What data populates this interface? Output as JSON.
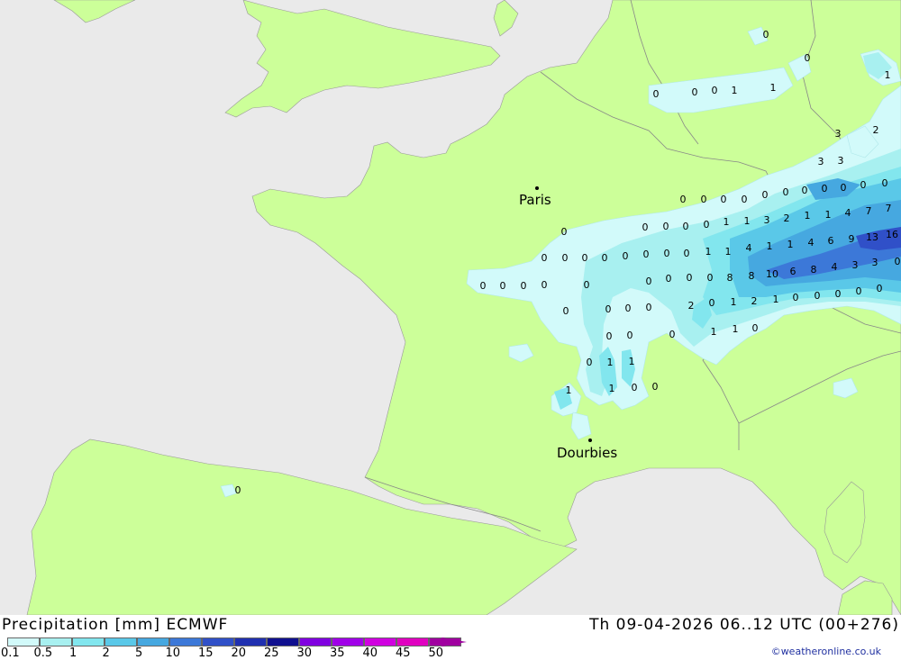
{
  "title": "Precipitation [mm] ECMWF",
  "datetime": "Th 09-04-2026 06..12 UTC (00+276)",
  "credit": "©weatheronline.co.uk",
  "colors": {
    "sea": "#eaeaea",
    "land": "#ccff99",
    "border": "#888888"
  },
  "legend": [
    {
      "label": "0.1",
      "color": "#d2fafa"
    },
    {
      "label": "0.5",
      "color": "#a8f0f0"
    },
    {
      "label": "1",
      "color": "#82e6ee"
    },
    {
      "label": "2",
      "color": "#5ac8e8"
    },
    {
      "label": "5",
      "color": "#46a8e0"
    },
    {
      "label": "10",
      "color": "#3c78d8"
    },
    {
      "label": "15",
      "color": "#3050c8"
    },
    {
      "label": "20",
      "color": "#2030b0"
    },
    {
      "label": "25",
      "color": "#101090"
    },
    {
      "label": "30",
      "color": "#8000e0"
    },
    {
      "label": "35",
      "color": "#a000e8"
    },
    {
      "label": "40",
      "color": "#d000e0"
    },
    {
      "label": "45",
      "color": "#e000c0"
    },
    {
      "label": "50",
      "color": "#a000a0"
    }
  ],
  "cities": [
    {
      "name": "Paris"
    },
    {
      "name": "Dourbies"
    }
  ],
  "values": [
    "0",
    "0",
    "0",
    "0",
    "0",
    "0",
    "0",
    "0",
    "0",
    "0",
    "0",
    "0",
    "0",
    "0",
    "0",
    "0",
    "1",
    "1",
    "1",
    "3",
    "2",
    "3",
    "3",
    "0",
    "0",
    "0",
    "0",
    "1",
    "1",
    "3",
    "2",
    "1",
    "1",
    "4",
    "7",
    "7",
    "0",
    "0",
    "0",
    "0",
    "0",
    "0",
    "0",
    "0",
    "0",
    "1",
    "1",
    "4",
    "1",
    "1",
    "4",
    "6",
    "9",
    "13",
    "16",
    "0",
    "0",
    "0",
    "0",
    "0",
    "0",
    "0",
    "0",
    "0",
    "8",
    "8",
    "10",
    "6",
    "8",
    "4",
    "3",
    "3",
    "0",
    "0",
    "0",
    "0",
    "2",
    "0",
    "1",
    "2",
    "1",
    "0",
    "0",
    "0",
    "0",
    "0",
    "0",
    "0",
    "1",
    "1",
    "0",
    "0",
    "0",
    "1",
    "1",
    "1",
    "1",
    "0",
    "0",
    "0",
    "0"
  ]
}
